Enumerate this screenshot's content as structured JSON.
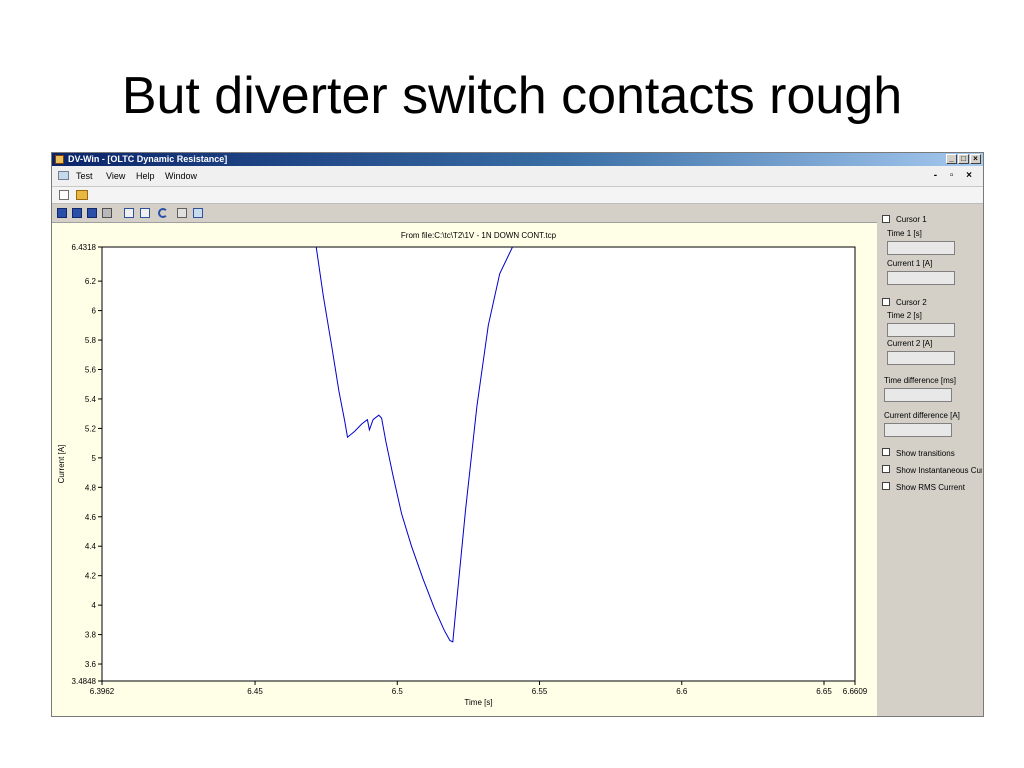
{
  "slide": {
    "title": "But diverter switch contacts rough"
  },
  "window": {
    "title": "DV-Win - [OLTC Dynamic Resistance]",
    "min_label": "_",
    "max_label": "□",
    "close_label": "×"
  },
  "menu": {
    "items": [
      "Test",
      "View",
      "Help",
      "Window"
    ],
    "mdi_controls": "- ▫ ×"
  },
  "plot": {
    "file_label": "From file:C:\\tc\\T2\\1V - 1N DOWN CONT.tcp",
    "line_color": "#0000cc"
  },
  "side": {
    "cursor1_label": "Cursor 1",
    "time1_label": "Time 1 [s]",
    "current1_label": "Current 1 [A]",
    "cursor2_label": "Cursor 2",
    "time2_label": "Time 2 [s]",
    "current2_label": "Current 2 [A]",
    "time_diff_label": "Time difference [ms]",
    "current_diff_label": "Current difference [A]",
    "show_transitions": "Show transitions",
    "show_instantaneous": "Show Instantaneous Cur",
    "show_rms": "Show RMS Current"
  },
  "chart_data": {
    "type": "line",
    "title": "From file:C:\\tc\\T2\\1V - 1N DOWN CONT.tcp",
    "xlabel": "Time [s]",
    "ylabel": "Current [A]",
    "xlim": [
      6.3962,
      6.6609
    ],
    "ylim": [
      3.4848,
      6.4318
    ],
    "x_ticks": [
      "6.3962",
      "6.45",
      "6.5",
      "6.55",
      "6.6",
      "6.65",
      "6.6609"
    ],
    "x_tick_values": [
      6.3962,
      6.45,
      6.5,
      6.55,
      6.6,
      6.65,
      6.6609
    ],
    "y_ticks": [
      "6.4318",
      "6.2",
      "6",
      "5.8",
      "5.6",
      "5.4",
      "5.2",
      "5",
      "4.8",
      "4.6",
      "4.4",
      "4.2",
      "4",
      "3.8",
      "3.6",
      "3.4848"
    ],
    "y_tick_values": [
      6.4318,
      6.2,
      6.0,
      5.8,
      5.6,
      5.4,
      5.2,
      5.0,
      4.8,
      4.6,
      4.4,
      4.2,
      4.0,
      3.8,
      3.6,
      3.4848
    ],
    "grid": false,
    "series": [
      {
        "x": [
          6.4715,
          6.474,
          6.477,
          6.4795,
          6.4815,
          6.4825,
          6.485,
          6.4875,
          6.4895,
          6.4902,
          6.4915,
          6.4935,
          6.4945,
          6.496,
          6.4985,
          6.5015,
          6.505,
          6.509,
          6.513,
          6.5165,
          6.5185,
          6.5195,
          6.521,
          6.524,
          6.528,
          6.532,
          6.536,
          6.5405
        ],
        "y": [
          6.4318,
          6.1,
          5.75,
          5.45,
          5.25,
          5.14,
          5.18,
          5.23,
          5.26,
          5.19,
          5.26,
          5.29,
          5.27,
          5.11,
          4.88,
          4.62,
          4.4,
          4.18,
          3.98,
          3.83,
          3.76,
          3.75,
          4.05,
          4.65,
          5.35,
          5.9,
          6.25,
          6.4318
        ]
      }
    ]
  }
}
